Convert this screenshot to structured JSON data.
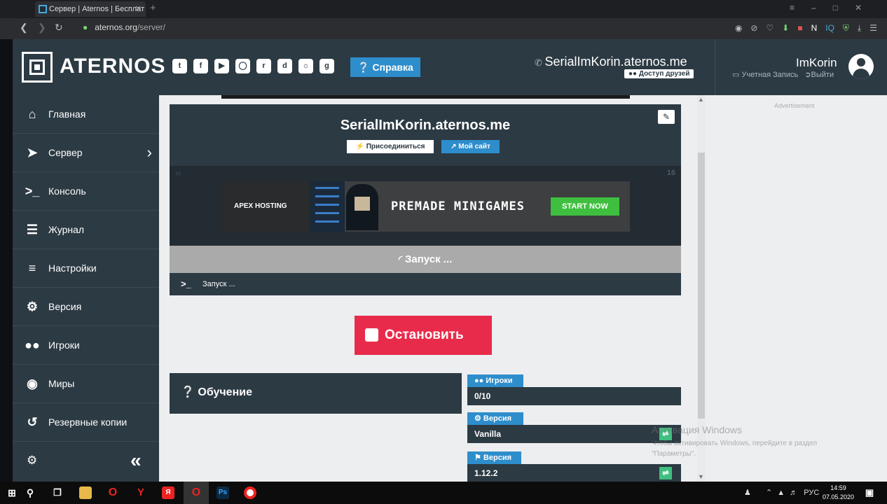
{
  "browser": {
    "tab_title": "Сервер | Aternos | Бесплат",
    "tab_close": "✕",
    "new_tab": "+",
    "url_host": "aternos.org",
    "url_path": "/server/"
  },
  "header": {
    "brand": "ATERNOS",
    "help_label": "Справка",
    "server_address": "SerialImKorin.aternos.me",
    "friends_access": "Доступ друзей",
    "username": "ImKorin",
    "account_label": "Учетная Запись",
    "logout_label": "Выйти"
  },
  "sidebar": {
    "items": [
      {
        "label": "Главная",
        "icon": "home-icon"
      },
      {
        "label": "Сервер",
        "icon": "rocket-icon"
      },
      {
        "label": "Консоль",
        "icon": "console-icon"
      },
      {
        "label": "Журнал",
        "icon": "log-icon"
      },
      {
        "label": "Настройки",
        "icon": "sliders-icon"
      },
      {
        "label": "Версия",
        "icon": "gears-icon"
      },
      {
        "label": "Игроки",
        "icon": "users-icon"
      },
      {
        "label": "Миры",
        "icon": "globe-icon"
      },
      {
        "label": "Резервные копии",
        "icon": "history-icon"
      }
    ]
  },
  "server": {
    "title": "SerialImKorin.aternos.me",
    "join_label": "Присоединиться",
    "site_label": "Мой сайт",
    "status": "Запуск ...",
    "console_text": "Запуск ...",
    "stop_label": "Остановить"
  },
  "ad": {
    "count": "16",
    "brand": "APEX HOSTING",
    "text": "PREMADE MINIGAMES",
    "cta": "START NOW",
    "advertisement": "Advertisement"
  },
  "tutorial": {
    "label": "Обучение"
  },
  "stats": {
    "players_label": "Игроки",
    "players_value": "0/10",
    "software_label": "Версия",
    "software_value": "Vanilla",
    "version_label": "Версия",
    "version_value": "1.12.2"
  },
  "watermark": {
    "line1": "Активация Windows",
    "line2": "Чтобы активировать Windows, перейдите в раздел",
    "line3": "\"Параметры\"."
  },
  "taskbar": {
    "lang": "РУС",
    "time": "14:59",
    "date": "07.05.2020"
  },
  "colors": {
    "dark_panel": "#2c3a43",
    "accent_blue": "#2e8dcb",
    "stop_red": "#e92b4b",
    "status_gray": "#aaaaaa",
    "shuffle_green": "#3fbf7f"
  }
}
